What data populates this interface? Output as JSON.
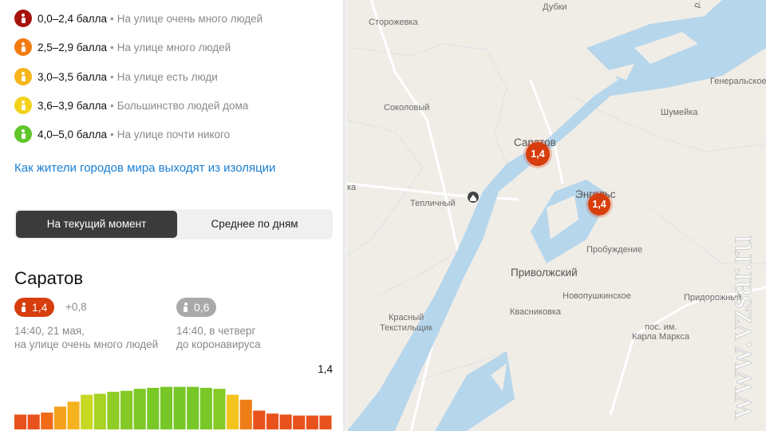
{
  "legend": [
    {
      "range": "0,0–2,4 балла",
      "desc": "На улице очень много людей",
      "color": "#a8120c"
    },
    {
      "range": "2,5–2,9 балла",
      "desc": "На улице много людей",
      "color": "#f27c12"
    },
    {
      "range": "3,0–3,5 балла",
      "desc": "На улице есть люди",
      "color": "#f5b51b"
    },
    {
      "range": "3,6–3,9 балла",
      "desc": "Большинство людей дома",
      "color": "#f2d21b"
    },
    {
      "range": "4,0–5,0 балла",
      "desc": "На улице почти никого",
      "color": "#5fc62b"
    }
  ],
  "separator": "•",
  "isolation_link": "Как жители городов мира выходят из изоляции",
  "modes": {
    "current": "На текущий момент",
    "average": "Среднее по дням"
  },
  "city": {
    "name": "Саратов",
    "now_value": "1,4",
    "delta": "+0,8",
    "before_value": "0,6",
    "now_caption_line1": "14:40, 21 мая,",
    "now_caption_line2": "на улице очень много людей",
    "before_caption_line1": "14:40, в четверг",
    "before_caption_line2": "до коронавируса"
  },
  "chart_data": {
    "type": "bar",
    "value_label": "1,4",
    "values": [
      1.5,
      1.5,
      1.7,
      2.3,
      2.8,
      3.5,
      3.6,
      3.8,
      3.9,
      4.1,
      4.2,
      4.3,
      4.3,
      4.3,
      4.2,
      4.1,
      3.5,
      3.0,
      1.9,
      1.6,
      1.5,
      1.4,
      1.4,
      1.4
    ],
    "colors": [
      "#e8521c",
      "#e8521c",
      "#f06a17",
      "#f4a21d",
      "#f4b21e",
      "#c8d823",
      "#a8d224",
      "#90cc26",
      "#86ca27",
      "#7ec828",
      "#7ac828",
      "#78c728",
      "#78c728",
      "#78c728",
      "#7ac828",
      "#86ca27",
      "#f4c41e",
      "#ee7d18",
      "#e8521c",
      "#e8521c",
      "#e8521c",
      "#e8521c",
      "#e8521c",
      "#e8521c"
    ],
    "ylim": [
      0,
      5
    ]
  },
  "map": {
    "places": [
      {
        "name": "Дубки",
        "cls": ""
      },
      {
        "name": "Сторожевка",
        "cls": ""
      },
      {
        "name": "Генеральское",
        "cls": ""
      },
      {
        "name": "Соколовый",
        "cls": ""
      },
      {
        "name": "Шумейка",
        "cls": ""
      },
      {
        "name": "Саратов",
        "cls": "big"
      },
      {
        "name": "Энгельс",
        "cls": "big"
      },
      {
        "name": "Тепличный",
        "cls": ""
      },
      {
        "name": "Пробуждение",
        "cls": ""
      },
      {
        "name": "Приволжский",
        "cls": "big"
      },
      {
        "name": "Новопушкинское",
        "cls": ""
      },
      {
        "name": "Придорожный",
        "cls": ""
      },
      {
        "name": "Квасниковка",
        "cls": ""
      },
      {
        "name": "Красный",
        "cls": ""
      },
      {
        "name": "Текстильщик",
        "cls": ""
      },
      {
        "name": "пос. им.",
        "cls": ""
      },
      {
        "name": "Карла Маркса",
        "cls": ""
      },
      {
        "name": "р. Во",
        "cls": ""
      },
      {
        "name": "ка",
        "cls": ""
      }
    ],
    "markers": [
      {
        "label": "1,4",
        "color": "#d83d0d"
      },
      {
        "label": "1,4",
        "color": "#d83d0d"
      }
    ],
    "watermark": "www.vzsar.ru"
  }
}
